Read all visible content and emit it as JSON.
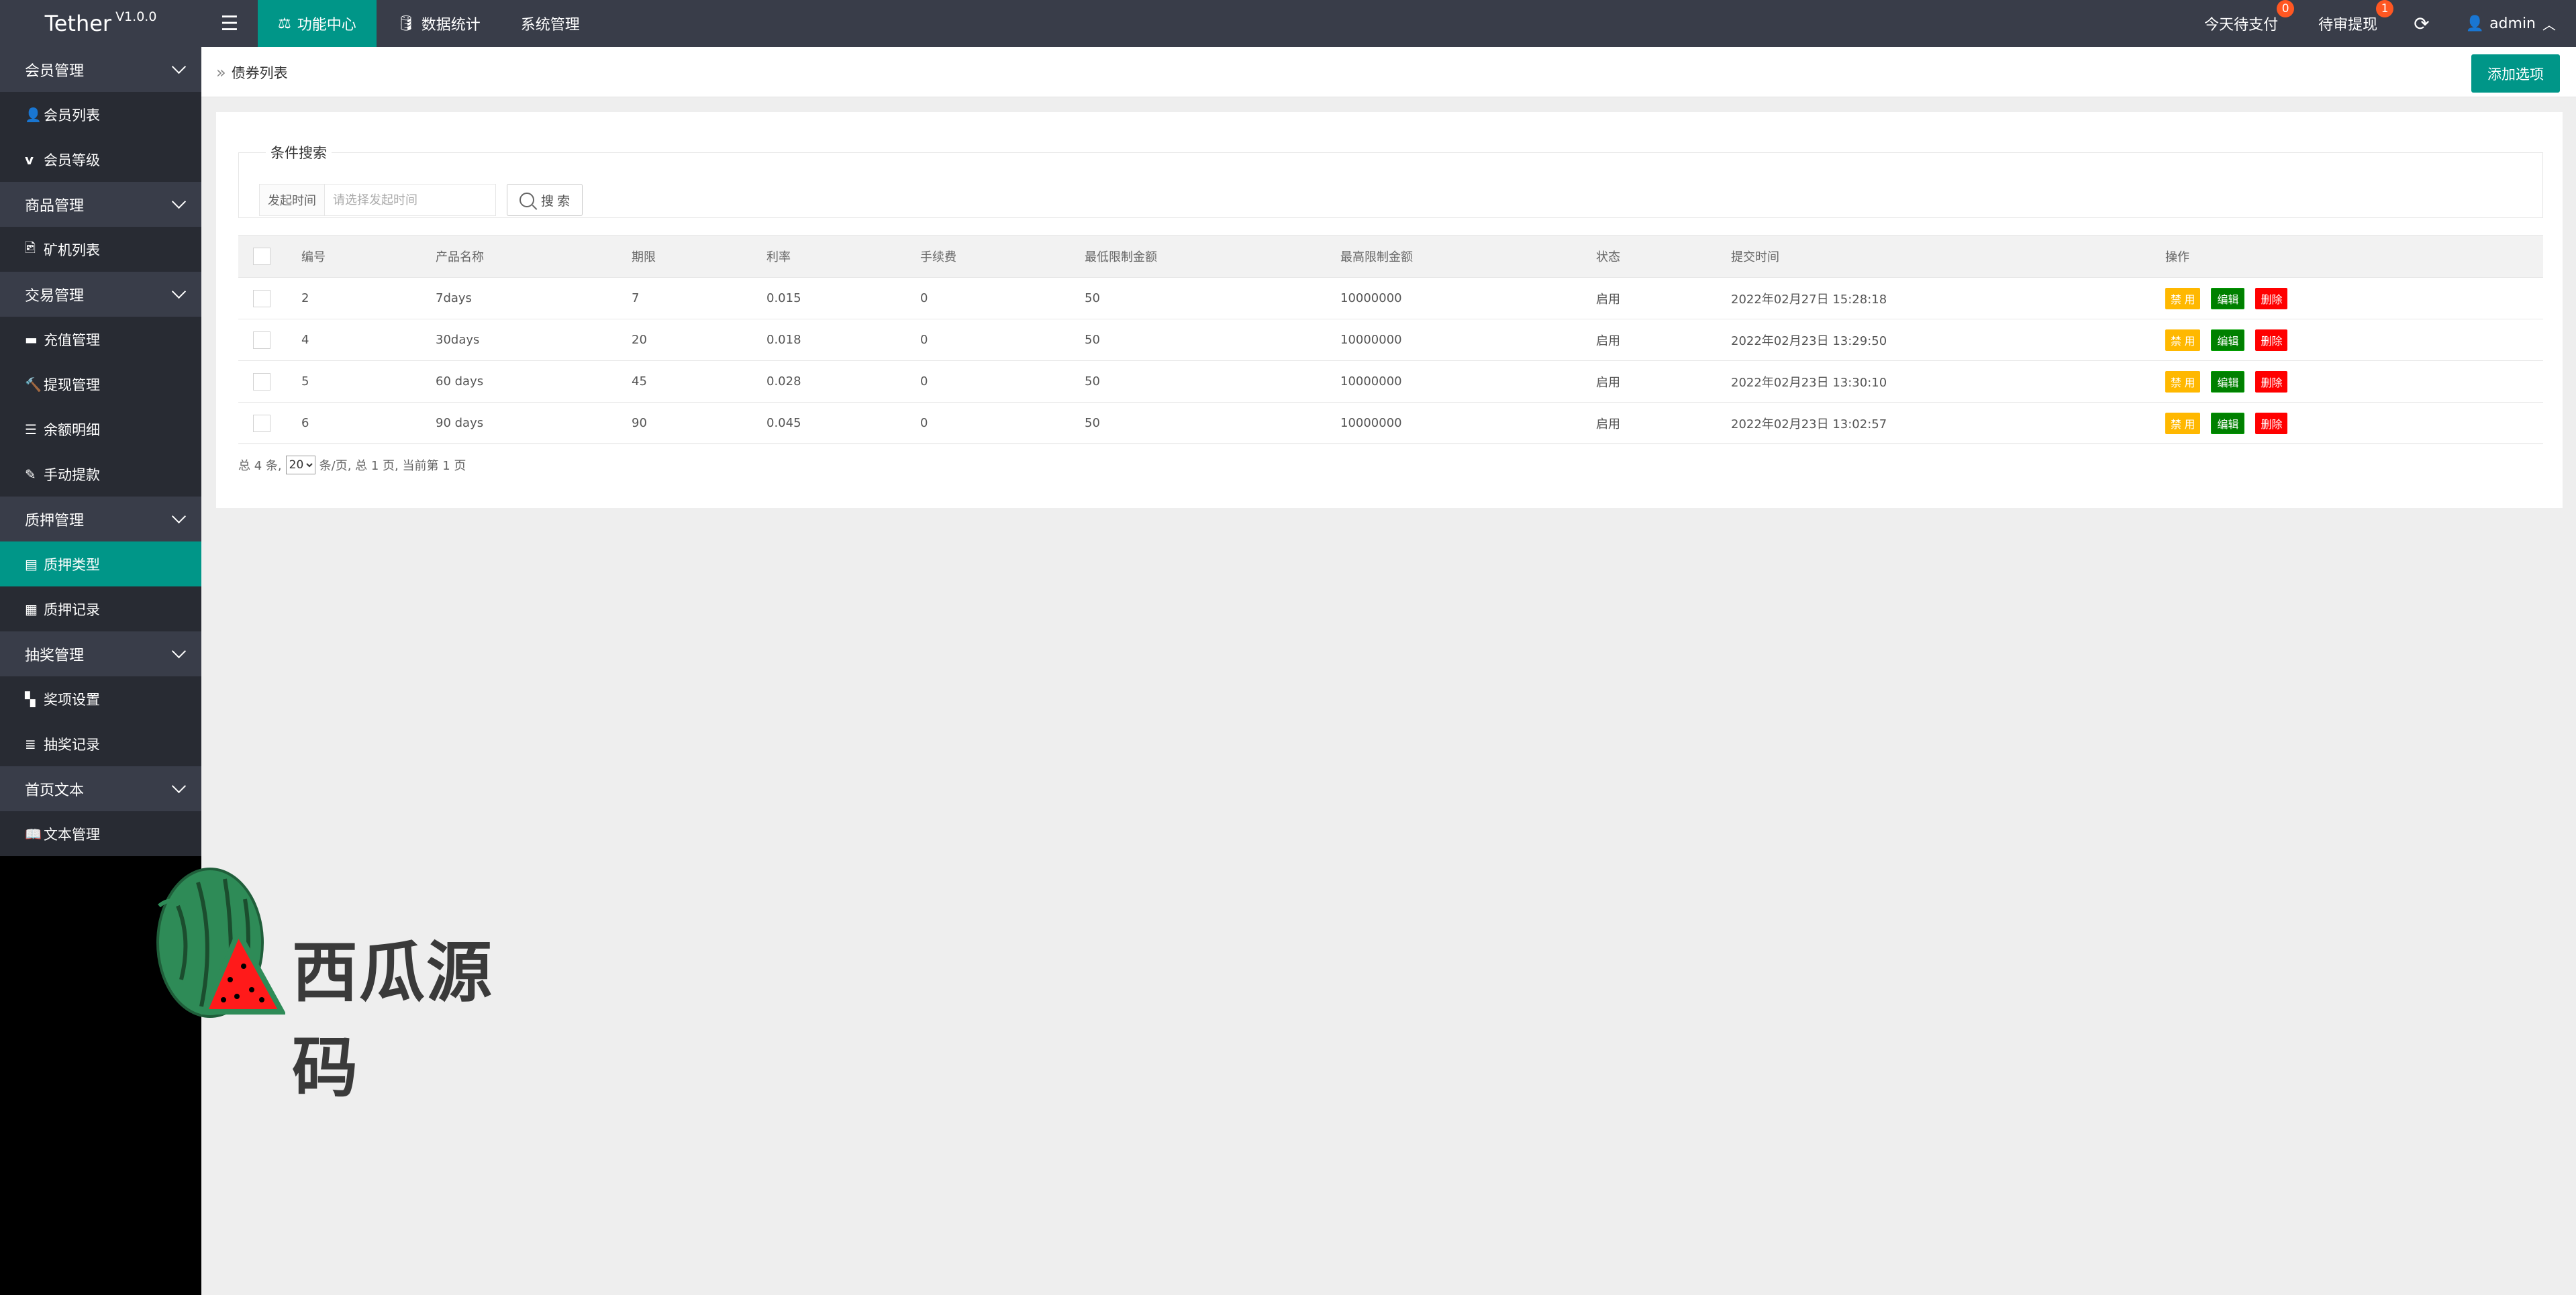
{
  "app": {
    "name": "Tether",
    "version": "V1.0.0"
  },
  "topnav": {
    "items": [
      {
        "label": "功能中心",
        "icon": "balance-icon",
        "active": true
      },
      {
        "label": "数据统计",
        "icon": "database-icon",
        "active": false
      },
      {
        "label": "系统管理",
        "icon": "",
        "active": false
      }
    ]
  },
  "topright": {
    "today_pay": {
      "label": "今天待支付",
      "badge": "0"
    },
    "pending_withdraw": {
      "label": "待审提现",
      "badge": "1"
    },
    "user": "admin"
  },
  "sidebar": {
    "groups": [
      {
        "label": "会员管理",
        "items": [
          {
            "label": "会员列表",
            "icon": "user-icon"
          },
          {
            "label": "会员等级",
            "icon": "vimeo-icon"
          }
        ]
      },
      {
        "label": "商品管理",
        "items": [
          {
            "label": "矿机列表",
            "icon": "image-edit-icon"
          }
        ]
      },
      {
        "label": "交易管理",
        "items": [
          {
            "label": "充值管理",
            "icon": "comment-icon"
          },
          {
            "label": "提现管理",
            "icon": "gavel-icon"
          },
          {
            "label": "余额明细",
            "icon": "list-icon"
          },
          {
            "label": "手动提款",
            "icon": "edit-icon"
          }
        ]
      },
      {
        "label": "质押管理",
        "items": [
          {
            "label": "质押类型",
            "icon": "list-alt-icon",
            "active": true
          },
          {
            "label": "质押记录",
            "icon": "table-icon"
          }
        ]
      },
      {
        "label": "抽奖管理",
        "items": [
          {
            "label": "奖项设置",
            "icon": "checkerboard-icon"
          },
          {
            "label": "抽奖记录",
            "icon": "align-icon"
          }
        ]
      },
      {
        "label": "首页文本",
        "items": [
          {
            "label": "文本管理",
            "icon": "book-icon"
          }
        ]
      }
    ]
  },
  "watermark": {
    "text": "西瓜源码"
  },
  "breadcrumb": {
    "title": "债券列表"
  },
  "add_button": "添加选项",
  "search": {
    "legend": "条件搜索",
    "label": "发起时间",
    "placeholder": "请选择发起时间",
    "button": "搜 索"
  },
  "table": {
    "columns": [
      "编号",
      "产品名称",
      "期限",
      "利率",
      "手续费",
      "最低限制金额",
      "最高限制金额",
      "状态",
      "提交时间",
      "操作"
    ],
    "rows": [
      {
        "id": "2",
        "name": "7days",
        "term": "7",
        "rate": "0.015",
        "fee": "0",
        "min": "50",
        "max": "10000000",
        "status": "启用",
        "time": "2022年02月27日 15:28:18"
      },
      {
        "id": "4",
        "name": "30days",
        "term": "20",
        "rate": "0.018",
        "fee": "0",
        "min": "50",
        "max": "10000000",
        "status": "启用",
        "time": "2022年02月23日 13:29:50"
      },
      {
        "id": "5",
        "name": "60 days",
        "term": "45",
        "rate": "0.028",
        "fee": "0",
        "min": "50",
        "max": "10000000",
        "status": "启用",
        "time": "2022年02月23日 13:30:10"
      },
      {
        "id": "6",
        "name": "90 days",
        "term": "90",
        "rate": "0.045",
        "fee": "0",
        "min": "50",
        "max": "10000000",
        "status": "启用",
        "time": "2022年02月23日 13:02:57"
      }
    ],
    "actions": {
      "disable": "禁 用",
      "edit": "编辑",
      "delete": "删除"
    }
  },
  "pager": {
    "prefix": "总 4 条,",
    "page_size": "20",
    "suffix": "条/页, 总 1 页, 当前第 1 页"
  },
  "colors": {
    "accent": "#009688",
    "header": "#393d49",
    "warn": "#ffb800",
    "edit": "#008000",
    "danger": "#ff0000"
  }
}
